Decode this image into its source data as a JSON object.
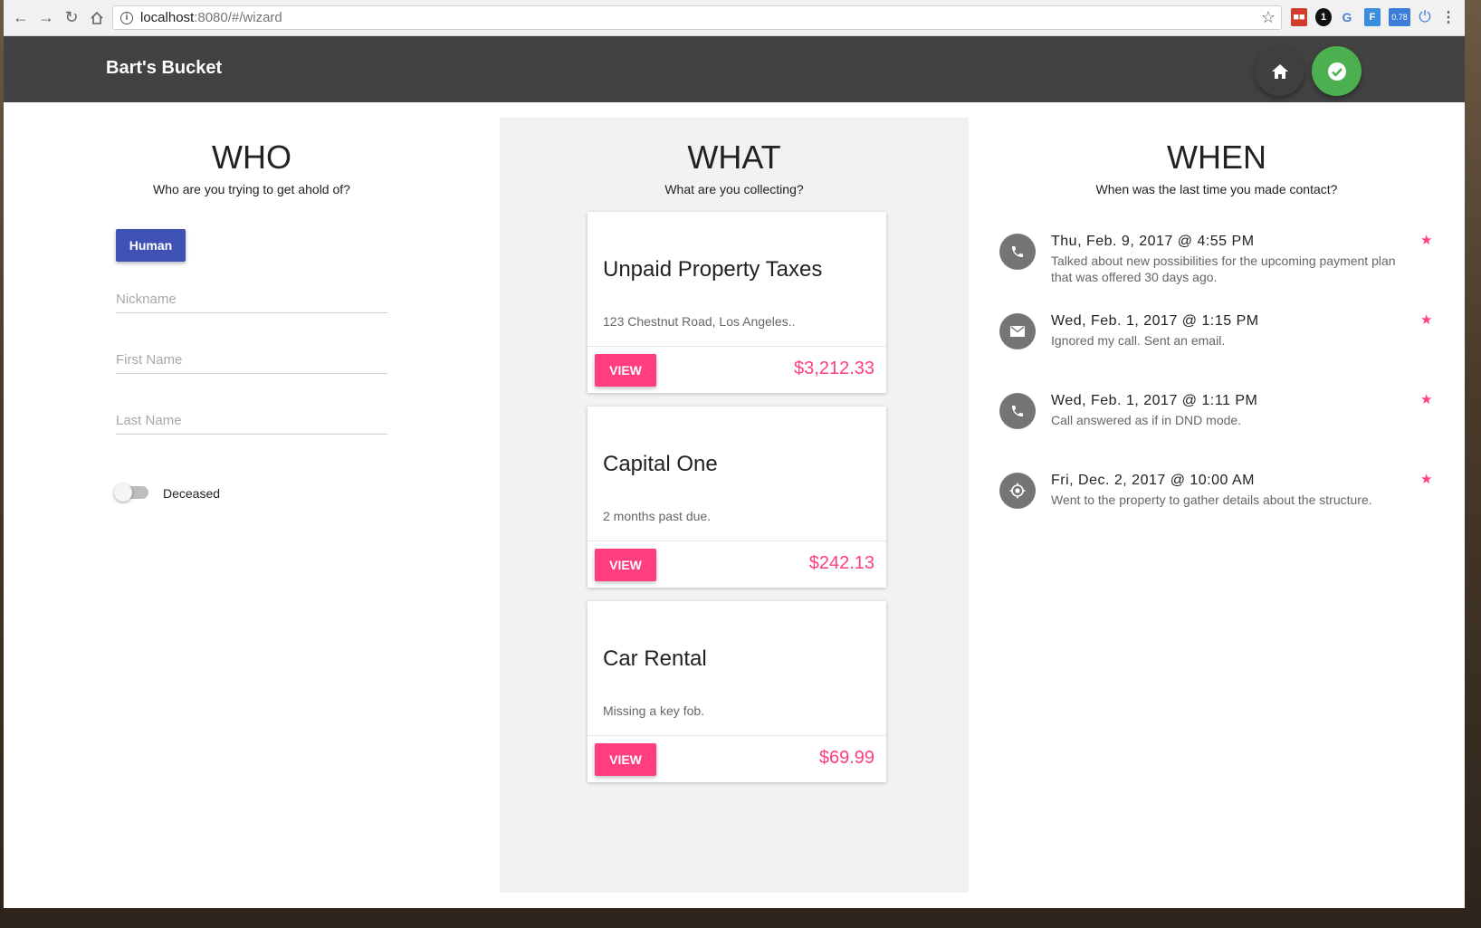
{
  "browser": {
    "url_host": "localhost",
    "url_path": ":8080/#/wizard",
    "ext_badge": "0.78"
  },
  "app": {
    "title": "Bart's Bucket"
  },
  "who": {
    "title": "WHO",
    "subtitle": "Who are you trying to get ahold of?",
    "type_button": "Human",
    "fields": {
      "nickname_placeholder": "Nickname",
      "first_name_placeholder": "First Name",
      "last_name_placeholder": "Last Name"
    },
    "deceased_label": "Deceased",
    "deceased": false
  },
  "what": {
    "title": "WHAT",
    "subtitle": "What are you collecting?",
    "cards": [
      {
        "title": "Unpaid Property Taxes",
        "description": "123 Chestnut Road, Los Angeles..",
        "action": "VIEW",
        "amount": "$3,212.33"
      },
      {
        "title": "Capital One",
        "description": "2 months past due.",
        "action": "VIEW",
        "amount": "$242.13"
      },
      {
        "title": "Car Rental",
        "description": "Missing a key fob.",
        "action": "VIEW",
        "amount": "$69.99"
      }
    ]
  },
  "when": {
    "title": "WHEN",
    "subtitle": "When was the last time you made contact?",
    "events": [
      {
        "icon": "phone-icon",
        "date": "Thu, Feb. 9, 2017 @ 4:55 PM",
        "text": "Talked about new possibilities for the upcoming payment plan that was offered 30 days ago."
      },
      {
        "icon": "email-icon",
        "date": "Wed, Feb. 1, 2017 @ 1:15 PM",
        "text": "Ignored my call. Sent an email."
      },
      {
        "icon": "phone-icon",
        "date": "Wed, Feb. 1, 2017 @ 1:11 PM",
        "text": "Call answered as if in DND mode."
      },
      {
        "icon": "location-icon",
        "date": "Fri, Dec. 2, 2017 @ 10:00 AM",
        "text": "Went to the property to gather details about the structure."
      }
    ]
  },
  "colors": {
    "appbar": "#424242",
    "primary": "#3f51b5",
    "accent": "#ff3d80",
    "success": "#4caf50"
  }
}
